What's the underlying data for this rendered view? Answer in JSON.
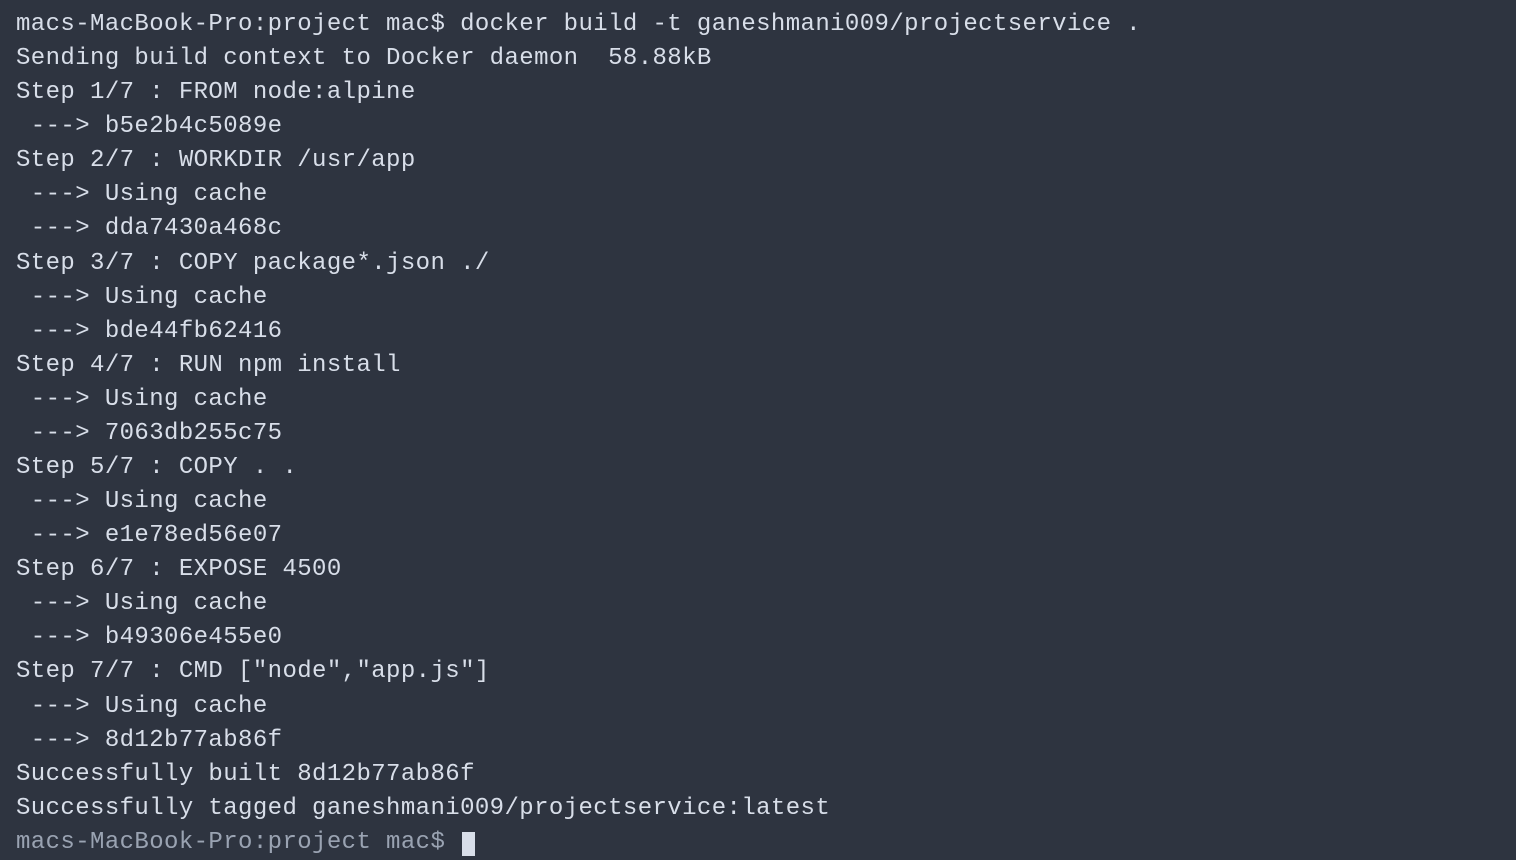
{
  "terminal": {
    "prompt1": "macs-MacBook-Pro:project mac$ docker build -t ganeshmani009/projectservice .",
    "lines": [
      "Sending build context to Docker daemon  58.88kB",
      "Step 1/7 : FROM node:alpine",
      " ---> b5e2b4c5089e",
      "Step 2/7 : WORKDIR /usr/app",
      " ---> Using cache",
      " ---> dda7430a468c",
      "Step 3/7 : COPY package*.json ./",
      " ---> Using cache",
      " ---> bde44fb62416",
      "Step 4/7 : RUN npm install",
      " ---> Using cache",
      " ---> 7063db255c75",
      "Step 5/7 : COPY . .",
      " ---> Using cache",
      " ---> e1e78ed56e07",
      "Step 6/7 : EXPOSE 4500",
      " ---> Using cache",
      " ---> b49306e455e0",
      "Step 7/7 : CMD [\"node\",\"app.js\"]",
      " ---> Using cache",
      " ---> 8d12b77ab86f",
      "Successfully built 8d12b77ab86f",
      "Successfully tagged ganeshmani009/projectservice:latest"
    ],
    "prompt2": "macs-MacBook-Pro:project mac$ "
  }
}
